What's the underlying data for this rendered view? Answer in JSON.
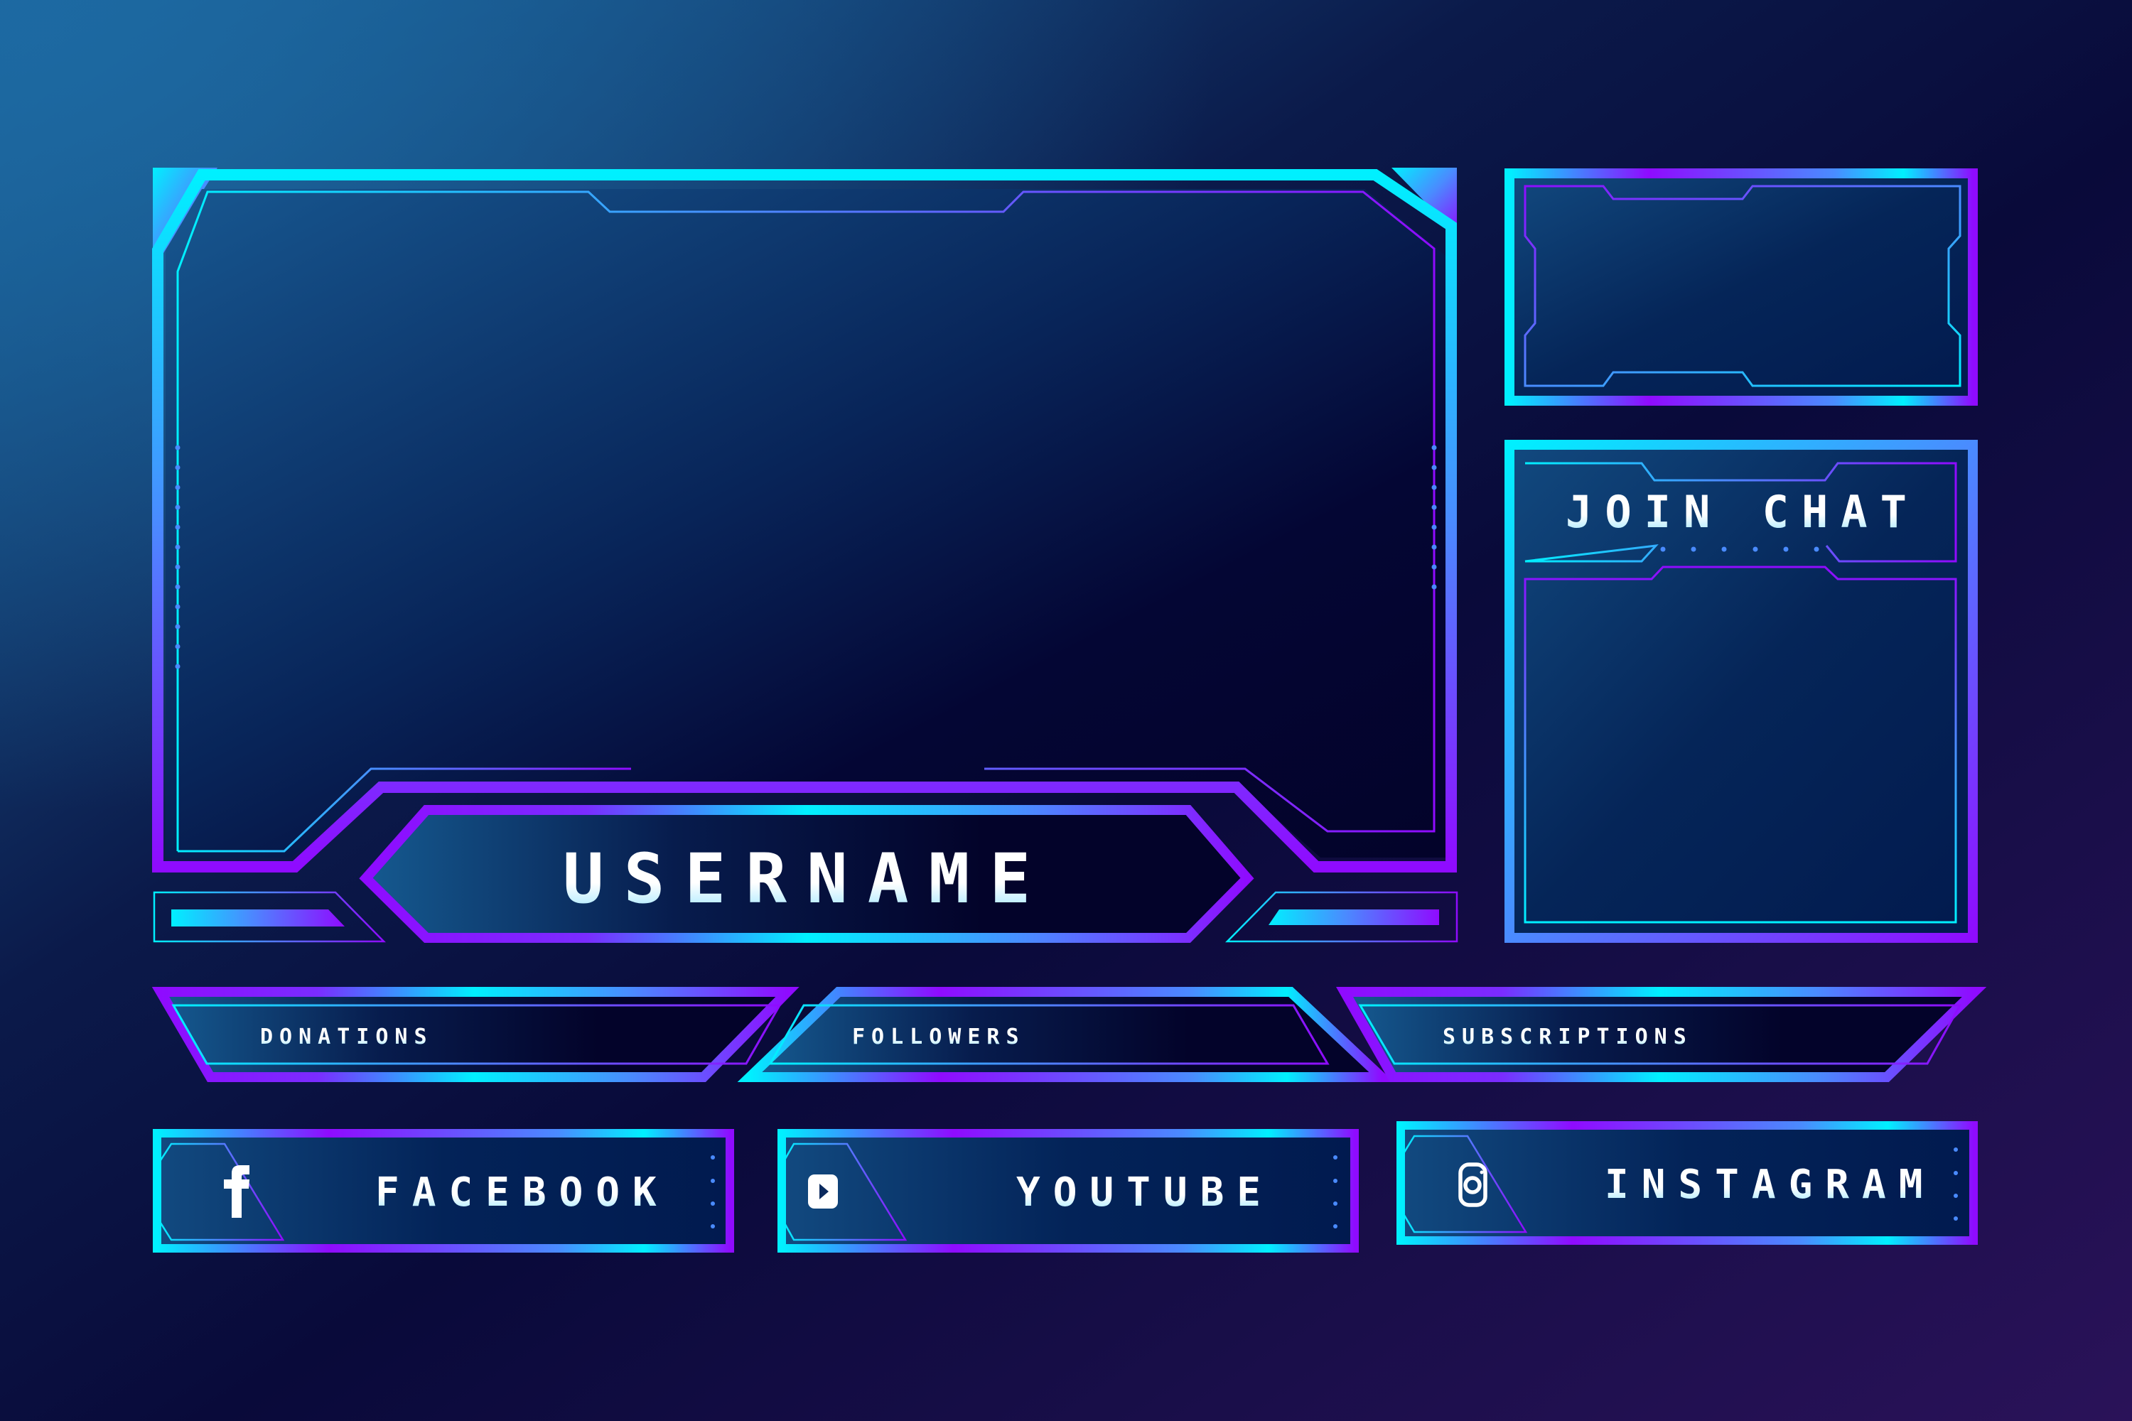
{
  "overlay": {
    "main_panel": {
      "username_label": "USERNAME"
    },
    "webcam_panel": {},
    "chat_panel": {
      "title": "JOIN CHAT"
    },
    "stat_bars": [
      {
        "label": "DONATIONS"
      },
      {
        "label": "FOLLOWERS"
      },
      {
        "label": "SUBSCRIPTIONS"
      }
    ],
    "social_buttons": [
      {
        "label": "FACEBOOK",
        "icon": "facebook-icon"
      },
      {
        "label": "YOUTUBE",
        "icon": "youtube-icon"
      },
      {
        "label": "INSTAGRAM",
        "icon": "instagram-icon"
      }
    ]
  },
  "colors": {
    "cyan": "#00f0ff",
    "blue": "#4a8bff",
    "violet": "#8f0bff",
    "panel_dark": "#03032a",
    "panel_blue": "#0c3a6e",
    "bg_top_left": "#1a5a8e",
    "bg_dark": "#0b0a35",
    "bg_purple": "#2a1259",
    "text_white": "#ffffff",
    "text_cyan": "#9fe6ff"
  }
}
